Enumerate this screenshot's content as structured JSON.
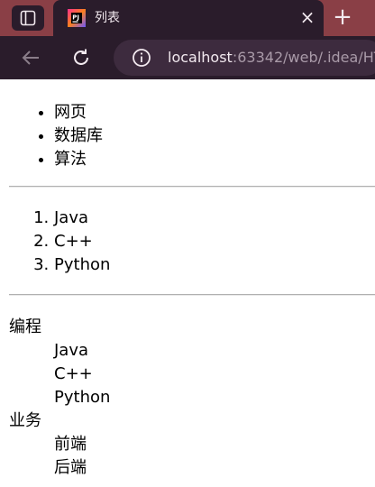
{
  "browser": {
    "tab": {
      "title": "列表",
      "close_glyph": "×",
      "favicon": "jetbrains-webstorm-icon"
    },
    "new_tab_glyph": "+",
    "address": {
      "host": "localhost",
      "rest": ":63342/web/.idea/HT"
    },
    "colors": {
      "tabbar": "#8a3f46",
      "chrome": "#2a1c2b",
      "address_bg": "#3d2b3e"
    }
  },
  "page": {
    "unordered_list": [
      "网页",
      "数据库",
      "算法"
    ],
    "ordered_list": [
      "Java",
      "C++",
      "Python"
    ],
    "definition_list": [
      {
        "term": "编程",
        "items": [
          "Java",
          "C++",
          "Python"
        ]
      },
      {
        "term": "业务",
        "items": [
          "前端",
          "后端"
        ]
      }
    ]
  }
}
